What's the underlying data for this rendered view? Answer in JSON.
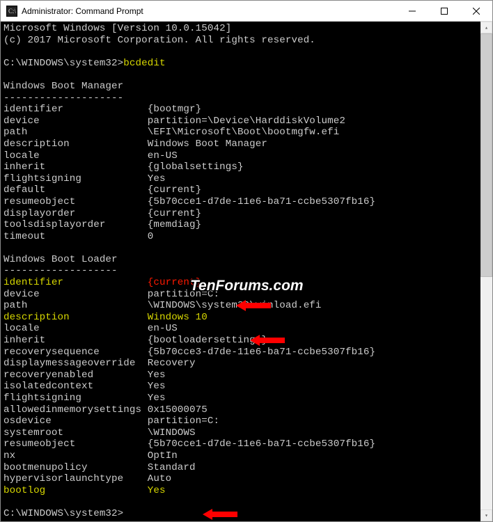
{
  "titlebar": {
    "title": "Administrator: Command Prompt"
  },
  "header": {
    "line1": "Microsoft Windows [Version 10.0.15042]",
    "line2": "(c) 2017 Microsoft Corporation. All rights reserved."
  },
  "prompt1": {
    "path": "C:\\WINDOWS\\system32>",
    "cmd": "bcdedit"
  },
  "bootmgr": {
    "heading": "Windows Boot Manager",
    "divider": "--------------------",
    "rows": [
      {
        "k": "identifier",
        "v": "{bootmgr}"
      },
      {
        "k": "device",
        "v": "partition=\\Device\\HarddiskVolume2"
      },
      {
        "k": "path",
        "v": "\\EFI\\Microsoft\\Boot\\bootmgfw.efi"
      },
      {
        "k": "description",
        "v": "Windows Boot Manager"
      },
      {
        "k": "locale",
        "v": "en-US"
      },
      {
        "k": "inherit",
        "v": "{globalsettings}"
      },
      {
        "k": "flightsigning",
        "v": "Yes"
      },
      {
        "k": "default",
        "v": "{current}"
      },
      {
        "k": "resumeobject",
        "v": "{5b70cce1-d7de-11e6-ba71-ccbe5307fb16}"
      },
      {
        "k": "displayorder",
        "v": "{current}"
      },
      {
        "k": "toolsdisplayorder",
        "v": "{memdiag}"
      },
      {
        "k": "timeout",
        "v": "0"
      }
    ]
  },
  "bootloader": {
    "heading": "Windows Boot Loader",
    "divider": "-------------------",
    "rows": [
      {
        "k": "identifier",
        "v": "{current}",
        "kcls": "yel",
        "vcls": "red"
      },
      {
        "k": "device",
        "v": "partition=C:"
      },
      {
        "k": "path",
        "v": "\\WINDOWS\\system32\\winload.efi"
      },
      {
        "k": "description",
        "v": "Windows 10",
        "kcls": "yel",
        "vcls": "yel"
      },
      {
        "k": "locale",
        "v": "en-US"
      },
      {
        "k": "inherit",
        "v": "{bootloadersettings}"
      },
      {
        "k": "recoverysequence",
        "v": "{5b70cce3-d7de-11e6-ba71-ccbe5307fb16}"
      },
      {
        "k": "displaymessageoverride",
        "v": "Recovery"
      },
      {
        "k": "recoveryenabled",
        "v": "Yes"
      },
      {
        "k": "isolatedcontext",
        "v": "Yes"
      },
      {
        "k": "flightsigning",
        "v": "Yes"
      },
      {
        "k": "allowedinmemorysettings",
        "v": "0x15000075"
      },
      {
        "k": "osdevice",
        "v": "partition=C:"
      },
      {
        "k": "systemroot",
        "v": "\\WINDOWS"
      },
      {
        "k": "resumeobject",
        "v": "{5b70cce1-d7de-11e6-ba71-ccbe5307fb16}"
      },
      {
        "k": "nx",
        "v": "OptIn"
      },
      {
        "k": "bootmenupolicy",
        "v": "Standard"
      },
      {
        "k": "hypervisorlaunchtype",
        "v": "Auto"
      },
      {
        "k": "bootlog",
        "v": "Yes",
        "kcls": "yel",
        "vcls": "yel"
      }
    ]
  },
  "prompt2": {
    "path": "C:\\WINDOWS\\system32>"
  },
  "watermark": "TenForums.com"
}
